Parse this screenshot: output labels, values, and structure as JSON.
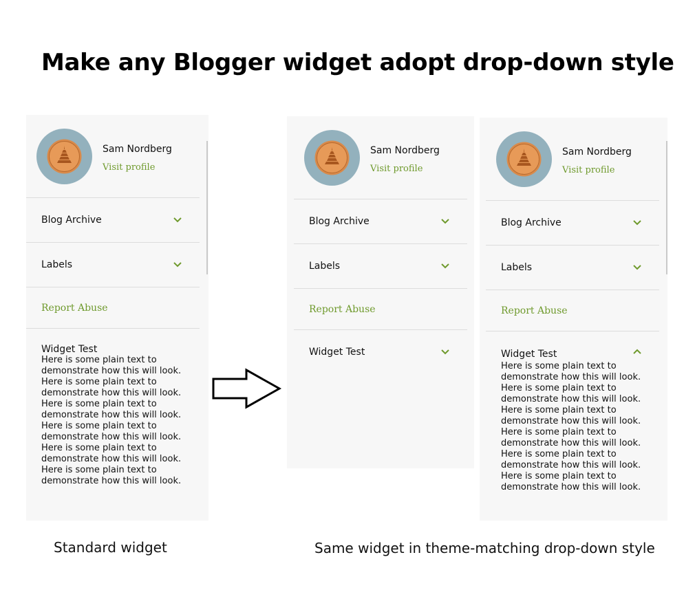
{
  "title": "Make any Blogger widget adopt drop-down style",
  "profile": {
    "name": "Sam Nordberg",
    "visit_label": "Visit profile",
    "avatar_icon": "coin-avatar-icon"
  },
  "sidebar": {
    "archive_label": "Blog Archive",
    "labels_label": "Labels",
    "report_label": "Report Abuse",
    "widget_title": "Widget Test",
    "widget_lines": [
      "Here is some plain text to",
      "demonstrate how this will look.",
      "Here is some plain text to",
      "demonstrate how this will look.",
      "Here is some plain text to",
      "demonstrate how this will look.",
      "Here is some plain text to",
      "demonstrate how this will look.",
      "Here is some plain text to",
      "demonstrate how this will look.",
      "Here is some plain text to",
      "demonstrate how this will look."
    ]
  },
  "captions": {
    "standard": "Standard widget",
    "dropdown": "Same widget in theme-matching drop-down style"
  },
  "colors": {
    "accent": "#6f9a2d",
    "panel_bg": "#f7f7f7",
    "avatar_bg": "#93b1bd"
  }
}
